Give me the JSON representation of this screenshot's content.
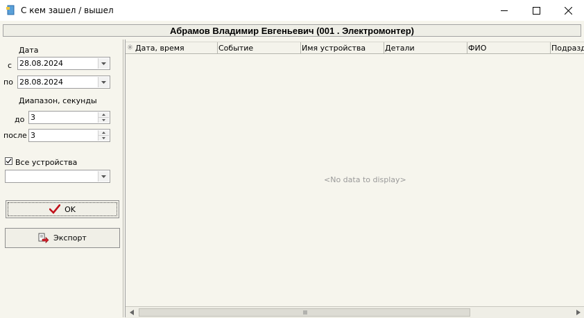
{
  "window": {
    "title": "С кем зашел / вышел",
    "minimize_icon": "minimize-icon",
    "maximize_icon": "maximize-icon",
    "close_icon": "close-icon"
  },
  "header": {
    "text": "Абрамов Владимир Евгеньевич (001 . Электромонтер)"
  },
  "filters": {
    "date_label": "Дата",
    "from_label": "с",
    "from_value": "28.08.2024",
    "to_label": "по",
    "to_value": "28.08.2024",
    "range_label": "Диапазон, секунды",
    "before_label": "до",
    "before_value": "3",
    "after_label": "после",
    "after_value": "3",
    "all_devices_label": "Все устройства",
    "all_devices_checked": true,
    "device_value": ""
  },
  "buttons": {
    "ok_label": "OK",
    "ok_icon": "checkmark-icon",
    "ok_icon_color": "#c0101a",
    "export_label": "Экспорт",
    "export_icon": "export-icon"
  },
  "grid": {
    "columns": [
      "Дата, время",
      "Событие",
      "Имя устройства",
      "Детали",
      "ФИО",
      "Подразде"
    ],
    "empty_text": "<No data to display>"
  }
}
